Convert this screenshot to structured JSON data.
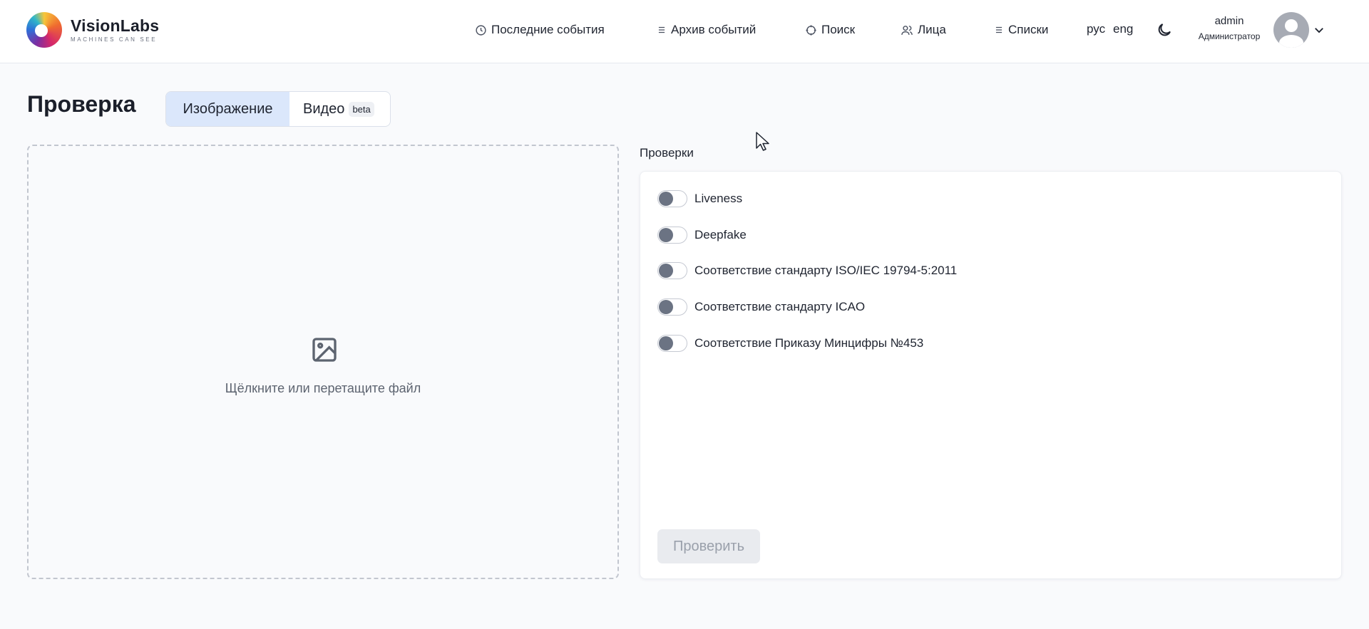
{
  "header": {
    "logo_name": "VisionLabs",
    "logo_tagline": "MACHINES CAN SEE",
    "nav": [
      {
        "label": "Последние события",
        "icon": "clock-icon"
      },
      {
        "label": "Архив событий",
        "icon": "list-icon"
      },
      {
        "label": "Поиск",
        "icon": "search-target-icon"
      },
      {
        "label": "Лица",
        "icon": "users-icon"
      },
      {
        "label": "Списки",
        "icon": "list-icon"
      }
    ],
    "languages": [
      "рус",
      "eng"
    ],
    "user": {
      "name": "admin",
      "role": "Администратор"
    }
  },
  "page": {
    "title": "Проверка",
    "tabs": [
      {
        "label": "Изображение",
        "active": true
      },
      {
        "label": "Видео",
        "badge": "beta",
        "active": false
      }
    ]
  },
  "dropzone": {
    "text": "Щёлкните или перетащите файл"
  },
  "checks": {
    "label": "Проверки",
    "items": [
      {
        "label": "Liveness",
        "enabled": false
      },
      {
        "label": "Deepfake",
        "enabled": false
      },
      {
        "label": "Соответствие стандарту ISO/IEC 19794-5:2011",
        "enabled": false
      },
      {
        "label": "Соответствие стандарту ICAO",
        "enabled": false
      },
      {
        "label": "Соответствие Приказу Минцифры №453",
        "enabled": false
      }
    ],
    "submit_label": "Проверить"
  },
  "colors": {
    "accent_tab": "#dbe7fb",
    "toggle_knob": "#6b7383",
    "disabled_button": "#e9ebef"
  }
}
